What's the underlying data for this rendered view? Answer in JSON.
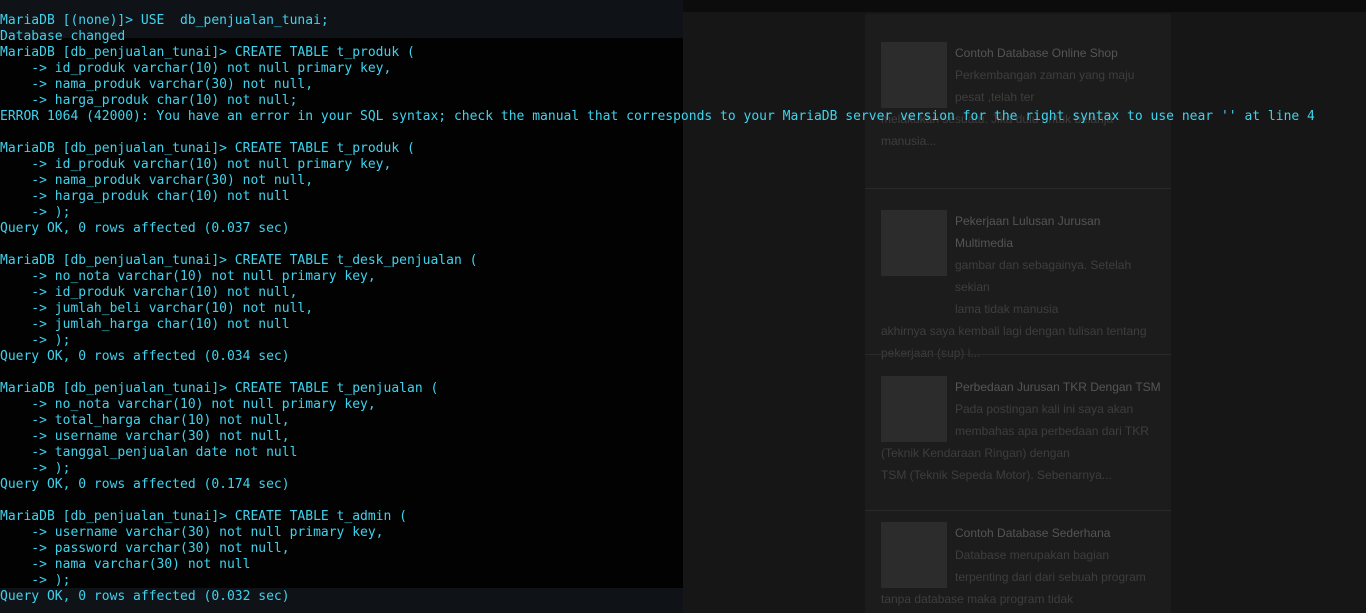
{
  "background_page": {
    "posts": [
      {
        "title": "Contoh Database Online Shop",
        "lines": [
          "Perkembangan zaman yang maju",
          "pesat ,telah ter",
          "melakukan sesuatu. Jika dulu untuk belanja",
          "manusia..."
        ]
      },
      {
        "title": "Pekerjaan Lulusan Jurusan Multimedia",
        "lines": [
          "gambar dan sebagainya. Setelah sekian",
          "lama tidak manusia",
          "akhirnya saya kembali lagi dengan tulisan tentang",
          "pekerjaan (sup) i..."
        ]
      },
      {
        "title": "Perbedaan Jurusan TKR Dengan TSM",
        "lines": [
          "Pada postingan kali ini saya akan",
          "membahas apa perbedaan dari TKR",
          "(Teknik Kendaraan Ringan) dengan",
          "TSM (Teknik Sepeda Motor). Sebenarnya..."
        ]
      },
      {
        "title": "Contoh Database Sederhana",
        "lines": [
          "Database merupakan bagian",
          "terpenting dari dari sebuah program",
          "tanpa database maka program tidak"
        ]
      }
    ]
  },
  "terminal": {
    "lines": [
      "MariaDB [(none)]> USE  db_penjualan_tunai;",
      "Database changed",
      "MariaDB [db_penjualan_tunai]> CREATE TABLE t_produk (",
      "    -> id_produk varchar(10) not null primary key,",
      "    -> nama_produk varchar(30) not null,",
      "    -> harga_produk char(10) not null;",
      "ERROR 1064 (42000): You have an error in your SQL syntax; check the manual that corresponds to your MariaDB server version for the right syntax to use near '' at line 4",
      "",
      "MariaDB [db_penjualan_tunai]> CREATE TABLE t_produk (",
      "    -> id_produk varchar(10) not null primary key,",
      "    -> nama_produk varchar(30) not null,",
      "    -> harga_produk char(10) not null",
      "    -> );",
      "Query OK, 0 rows affected (0.037 sec)",
      "",
      "MariaDB [db_penjualan_tunai]> CREATE TABLE t_desk_penjualan (",
      "    -> no_nota varchar(10) not null primary key,",
      "    -> id_produk varchar(10) not null,",
      "    -> jumlah_beli varchar(10) not null,",
      "    -> jumlah_harga char(10) not null",
      "    -> );",
      "Query OK, 0 rows affected (0.034 sec)",
      "",
      "MariaDB [db_penjualan_tunai]> CREATE TABLE t_penjualan (",
      "    -> no_nota varchar(10) not null primary key,",
      "    -> total_harga char(10) not null,",
      "    -> username varchar(30) not null,",
      "    -> tanggal_penjualan date not null",
      "    -> );",
      "Query OK, 0 rows affected (0.174 sec)",
      "",
      "MariaDB [db_penjualan_tunai]> CREATE TABLE t_admin (",
      "    -> username varchar(30) not null primary key,",
      "    -> password varchar(30) not null,",
      "    -> nama varchar(30) not null",
      "    -> );",
      "Query OK, 0 rows affected (0.032 sec)"
    ]
  },
  "colors": {
    "terminal_text": "#3fd3ee",
    "terminal_bg": "#020202"
  }
}
